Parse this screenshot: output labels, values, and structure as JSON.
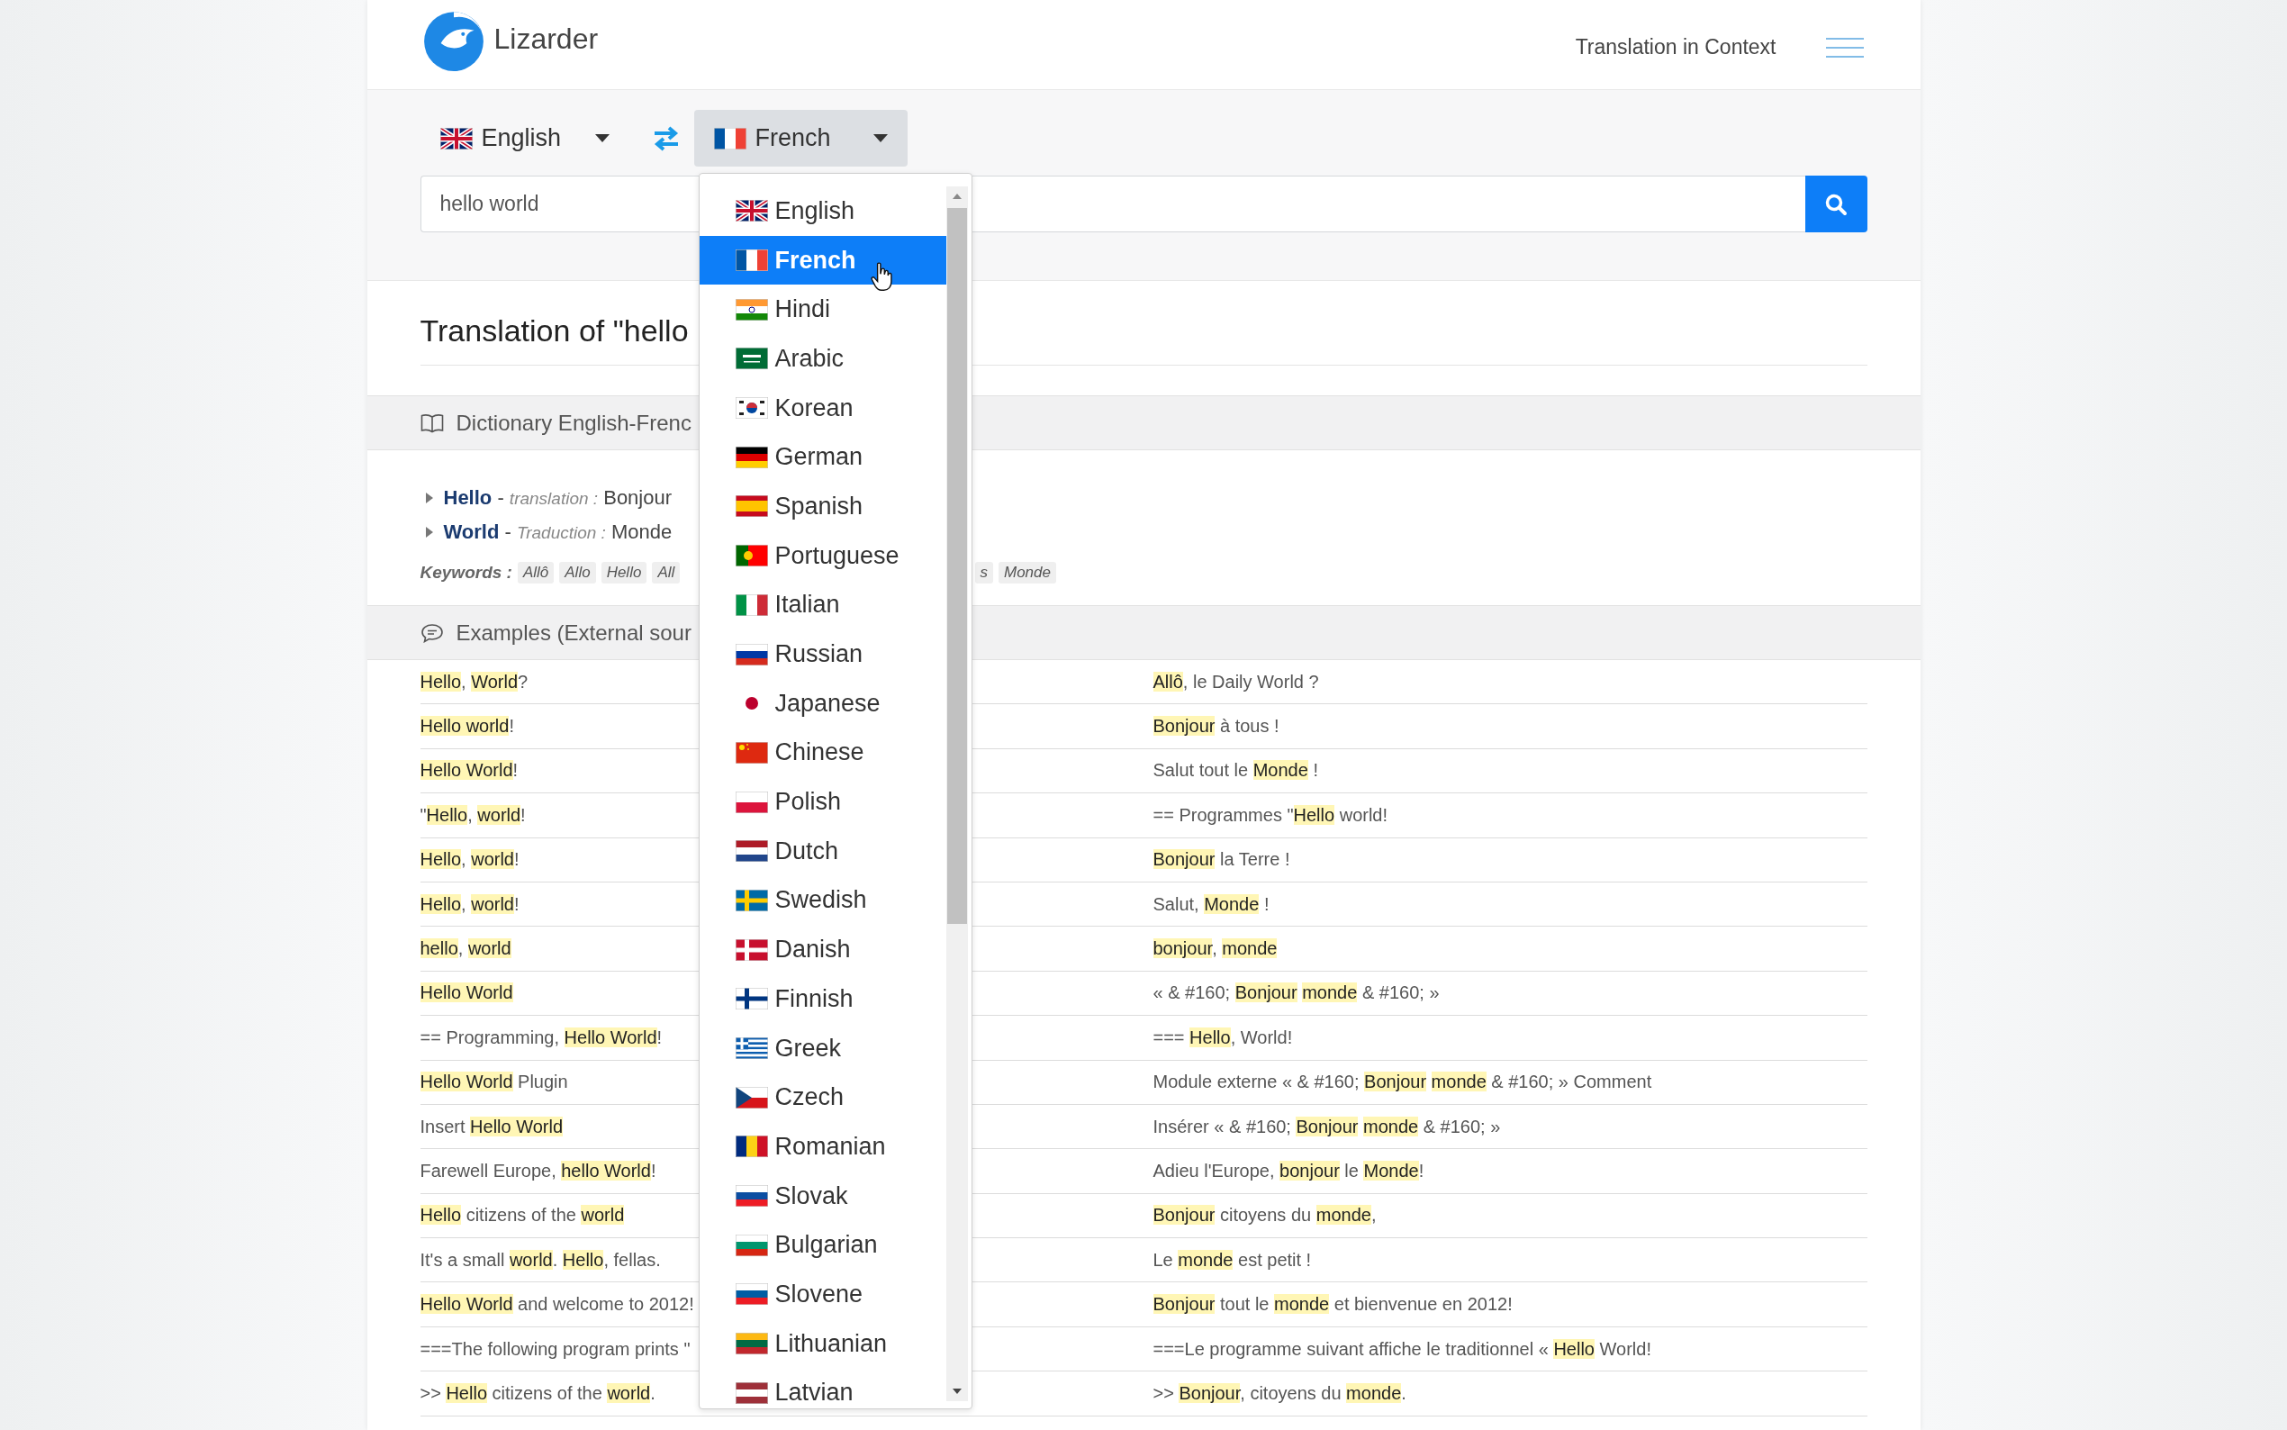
{
  "header": {
    "brand": "Lizarder",
    "nav_link": "Translation in Context"
  },
  "language_bar": {
    "source": {
      "label": "English",
      "open": false
    },
    "target": {
      "label": "French",
      "open": true
    }
  },
  "search": {
    "value": "hello world"
  },
  "language_menu": {
    "items": [
      {
        "label": "English",
        "selected": false
      },
      {
        "label": "French",
        "selected": true
      },
      {
        "label": "Hindi",
        "selected": false
      },
      {
        "label": "Arabic",
        "selected": false
      },
      {
        "label": "Korean",
        "selected": false
      },
      {
        "label": "German",
        "selected": false
      },
      {
        "label": "Spanish",
        "selected": false
      },
      {
        "label": "Portuguese",
        "selected": false
      },
      {
        "label": "Italian",
        "selected": false
      },
      {
        "label": "Russian",
        "selected": false
      },
      {
        "label": "Japanese",
        "selected": false
      },
      {
        "label": "Chinese",
        "selected": false
      },
      {
        "label": "Polish",
        "selected": false
      },
      {
        "label": "Dutch",
        "selected": false
      },
      {
        "label": "Swedish",
        "selected": false
      },
      {
        "label": "Danish",
        "selected": false
      },
      {
        "label": "Finnish",
        "selected": false
      },
      {
        "label": "Greek",
        "selected": false
      },
      {
        "label": "Czech",
        "selected": false
      },
      {
        "label": "Romanian",
        "selected": false
      },
      {
        "label": "Slovak",
        "selected": false
      },
      {
        "label": "Bulgarian",
        "selected": false
      },
      {
        "label": "Slovene",
        "selected": false
      },
      {
        "label": "Lithuanian",
        "selected": false
      },
      {
        "label": "Latvian",
        "selected": false
      }
    ]
  },
  "title": "Translation of \"hello",
  "dictionary": {
    "heading": "Dictionary English-Frenc",
    "entries": [
      {
        "text": "**Hello** - *translation :* Bonjour"
      },
      {
        "text": "**World** - *Traduction :* Monde"
      }
    ],
    "keywords_label": "Keywords :",
    "keywords": [
      "Allô",
      "Allo",
      "Hello",
      "All"
    ],
    "keywords_after_menu": [
      "s",
      "Monde"
    ]
  },
  "examples": {
    "heading": "Examples (External sour",
    "rows": [
      {
        "source": "**Hello**, **World**?",
        "target": "**Allô**, le Daily World ?"
      },
      {
        "source": "**Hello world**!",
        "target": "**Bonjour** à tous !"
      },
      {
        "source": "**Hello World**!",
        "target": "Salut tout le **Monde** !"
      },
      {
        "source": "\"**Hello**, **world**!",
        "target": "== Programmes \"**Hello** world!"
      },
      {
        "source": "**Hello**, **world**!",
        "target": "**Bonjour** la Terre !"
      },
      {
        "source": "**Hello**, **world**!",
        "target": "Salut, **Monde** !"
      },
      {
        "source": "**hello**, **world**",
        "target": "**bonjour**, **monde**"
      },
      {
        "source": "**Hello World**",
        "target": "« & #160; **Bonjour** **monde** & #160; »"
      },
      {
        "source": "== Programming, **Hello World**!",
        "target": "=== **Hello**, World!"
      },
      {
        "source": "**Hello World** Plugin",
        "target": "Module externe « & #160; **Bonjour** **monde** & #160; » Comment"
      },
      {
        "source": "Insert **Hello World**",
        "target": "Insérer « & #160; **Bonjour** **monde** & #160; »"
      },
      {
        "source": "Farewell Europe, **hello World**!",
        "target": "Adieu l'Europe, **bonjour** le **Monde**!"
      },
      {
        "source": "**Hello** citizens of the **world**",
        "target": "**Bonjour** citoyens du **monde**,"
      },
      {
        "source": "It's a small **world**. **Hello**, fellas.",
        "target": "Le **monde** est petit !"
      },
      {
        "source": "**Hello World** and welcome to 2012!",
        "target": "**Bonjour** tout le **monde** et bienvenue en 2012!"
      },
      {
        "source": "===The following program prints \"",
        "target": "===Le programme suivant affiche le traditionnel « **Hello** World!"
      },
      {
        "source": ">> **Hello** citizens of the **world**.",
        "target": ">> **Bonjour**, citoyens du **monde**."
      }
    ]
  }
}
